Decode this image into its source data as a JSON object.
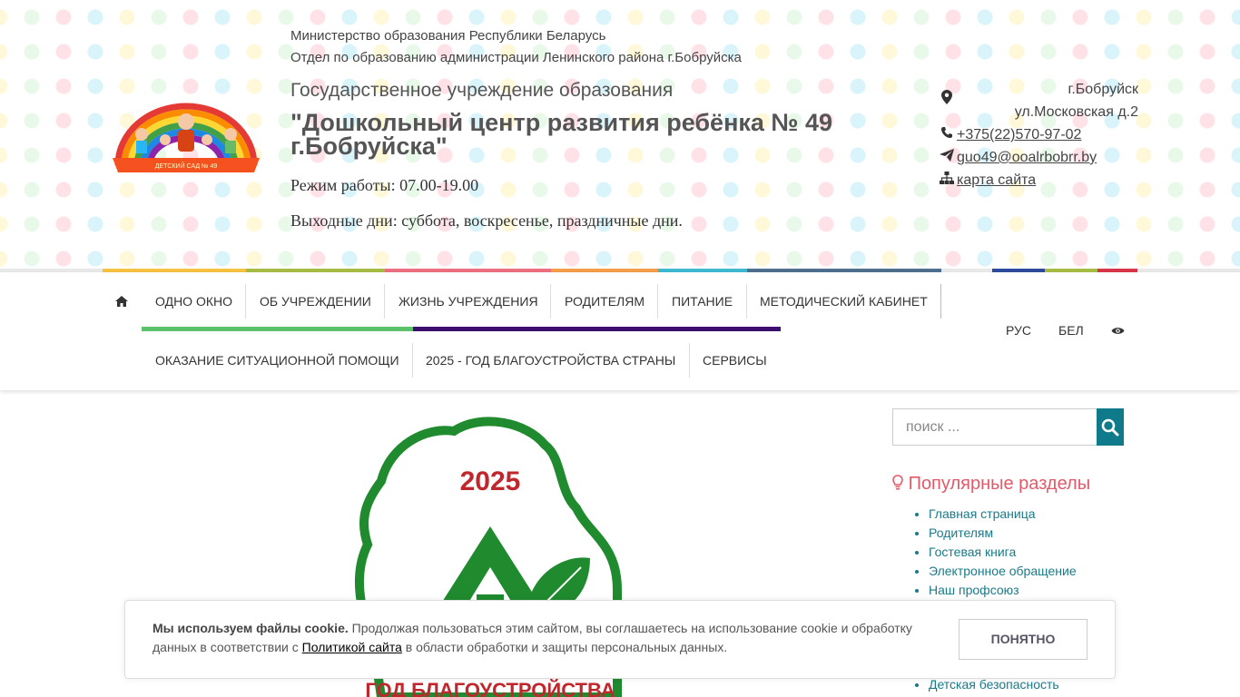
{
  "header": {
    "ministry": "Министерство образования Республики Беларусь",
    "department": "Отдел по образованию администрации Ленинского района г.Бобруйска",
    "org_type": "Государственное учреждение образования",
    "org_name": "\"Дошкольный центр развития ребёнка № 49 г.Бобруйска\"",
    "hours": "Режим работы: 07.00-19.00",
    "days_off": "Выходные дни: суббота, воскресенье, праздничные дни.",
    "logo_caption": "ДЕТСКИЙ САД № 49"
  },
  "contacts": {
    "address": "г.Бобруйск ул.Московская д.2",
    "phone": "+375(22)570-97-02",
    "email": "guo49@ooalrbobrr.by",
    "sitemap": "карта сайта"
  },
  "nav": {
    "row1": [
      "ОДНО ОКНО",
      "ОБ УЧРЕЖДЕНИИ",
      "ЖИЗНЬ УЧРЕЖДЕНИЯ",
      "РОДИТЕЛЯМ",
      "ПИТАНИЕ",
      "МЕТОДИЧЕСКИЙ КАБИНЕТ"
    ],
    "row2": [
      "ОКАЗАНИЕ СИТУАЦИОННОЙ ПОМОЩИ",
      "2025 - ГОД БЛАГОУСТРОЙСТВА СТРАНЫ",
      "СЕРВИСЫ"
    ],
    "lang": [
      "РУС",
      "БЕЛ"
    ]
  },
  "search": {
    "placeholder": "поиск ..."
  },
  "popular": {
    "title": "Популярные разделы",
    "items": [
      "Главная страница",
      "Родителям",
      "Гостевая книга",
      "Электронное обращение",
      "Наш профсоюз"
    ],
    "last_visible": "Детская безопасность"
  },
  "banner": {
    "year": "2025",
    "caption": "ГОД БЛАГОУСТРОЙСТВА"
  },
  "cookie": {
    "bold": "Мы используем файлы cookie.",
    "text1": " Продолжая пользоваться этим сайтом, вы соглашаетесь на использование cookie и обработку данных в соответствии с ",
    "link": "Политикой сайта",
    "text2": " в области обработки и защиты персональных данных.",
    "button": "ПОНЯТНО"
  },
  "colors": {
    "accent": "#0f7a8a",
    "popular_title": "#e25a6a",
    "link": "#1a7a8a",
    "banner_green": "#1f8a2e",
    "banner_red": "#c0272d"
  }
}
